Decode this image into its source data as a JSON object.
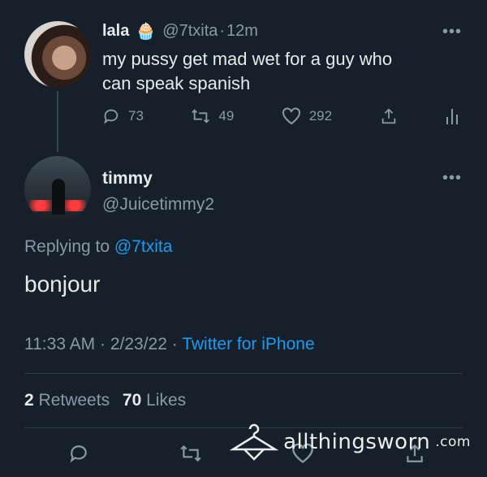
{
  "original_tweet": {
    "display_name": "lala",
    "name_emoji": "🧁",
    "handle": "@7txita",
    "separator": "·",
    "time_ago": "12m",
    "text_line1": "my pussy get mad wet for a guy who",
    "text_line2": "can speak spanish",
    "stats": {
      "replies": "73",
      "retweets": "49",
      "likes": "292"
    }
  },
  "reply_tweet": {
    "display_name": "timmy",
    "handle": "@Juicetimmy2",
    "replying_prefix": "Replying to",
    "replying_handle": "@7txita",
    "text": "bonjour",
    "timestamp": "11:33 AM · 2/23/22",
    "separator": "·",
    "source": "Twitter for iPhone",
    "retweets_count": "2",
    "retweets_label": "Retweets",
    "likes_count": "70",
    "likes_label": "Likes"
  },
  "watermark": {
    "brand": "allthingsworn",
    "domain": ".com"
  },
  "colors": {
    "background": "#15202b",
    "text": "#e7e9ea",
    "muted": "#8b98a5",
    "link": "#1d9bf0"
  }
}
